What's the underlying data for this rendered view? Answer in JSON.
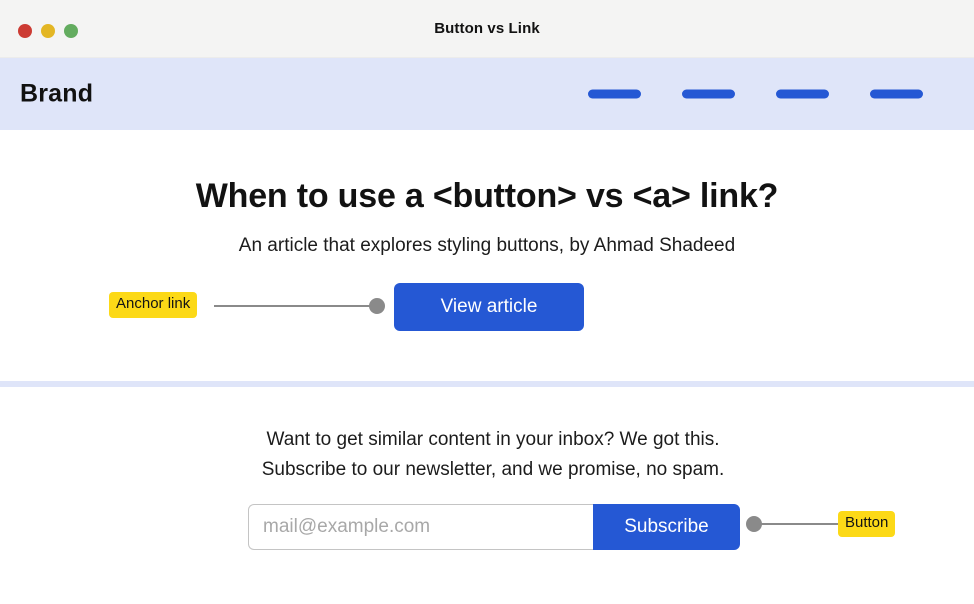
{
  "window": {
    "title": "Button vs Link",
    "controls": [
      {
        "name": "close",
        "color": "#cc3b33"
      },
      {
        "name": "minimize",
        "color": "#e3b624"
      },
      {
        "name": "maximize",
        "color": "#63ac5f"
      }
    ]
  },
  "navbar": {
    "brand": "Brand",
    "background": "#dfe5f9",
    "link_placeholders": 4,
    "link_color": "#2558d4"
  },
  "hero": {
    "title": "When to use a <button> vs <a> link?",
    "subtitle": "An article that explores styling buttons, by Ahmad Shadeed",
    "cta_label": "View article",
    "cta_color": "#2558d4"
  },
  "annotations": {
    "anchor": {
      "label": "Anchor link",
      "background": "#fcd917",
      "connector_color": "#8a8a8a"
    },
    "button": {
      "label": "Button",
      "background": "#fcd917",
      "connector_color": "#8a8a8a"
    }
  },
  "newsletter": {
    "copy_line1": "Want to get similar content in your inbox? We got this.",
    "copy_line2": "Subscribe to our newsletter, and we promise, no spam.",
    "email_placeholder": "mail@example.com",
    "email_value": "",
    "submit_label": "Subscribe",
    "submit_color": "#2558d4"
  }
}
